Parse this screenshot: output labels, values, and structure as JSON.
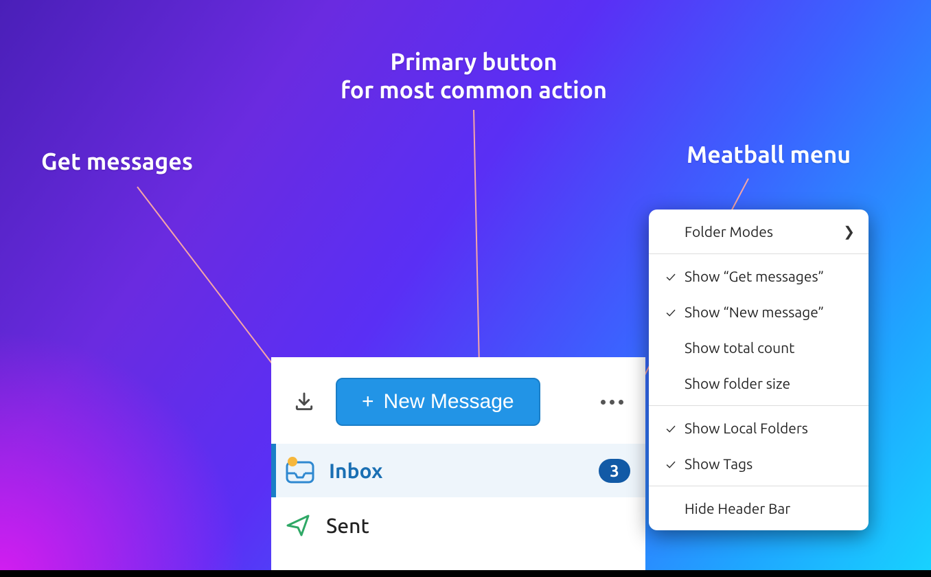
{
  "annotations": {
    "primary": "Primary button\nfor most common action",
    "get_messages": "Get messages",
    "meatball": "Meatball menu"
  },
  "toolbar": {
    "new_message_label": "New Message"
  },
  "folders": {
    "inbox": {
      "label": "Inbox",
      "badge": "3"
    },
    "sent": {
      "label": "Sent"
    }
  },
  "menu": {
    "folder_modes": "Folder Modes",
    "show_get_messages": "Show “Get messages”",
    "show_new_message": "Show “New message”",
    "show_total_count": "Show total count",
    "show_folder_size": "Show folder size",
    "show_local_folders": "Show Local Folders",
    "show_tags": "Show Tags",
    "hide_header_bar": "Hide Header Bar"
  }
}
